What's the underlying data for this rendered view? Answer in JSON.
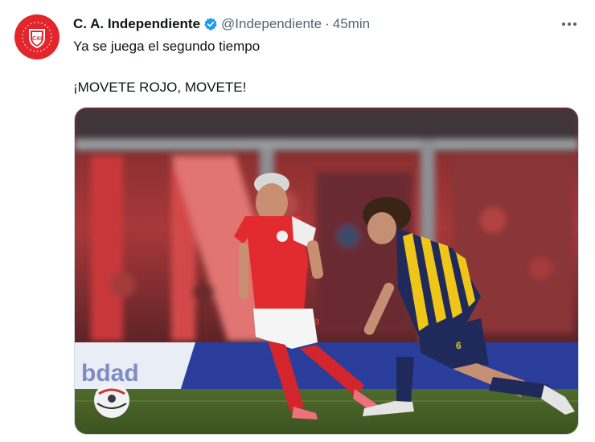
{
  "tweet": {
    "display_name": "C. A. Independiente",
    "handle": "@Independiente",
    "separator": "·",
    "time": "45min",
    "text_line_1": "Ya se juega el segundo tiempo",
    "text_line_2": "¡MOVETE ROJO, MOVETE!",
    "avatar_label": "CAI",
    "verified_icon": "verified-badge-icon",
    "more_icon": "more-options-icon"
  },
  "media": {
    "board_text": "bdad",
    "player_red_number": "9",
    "player_blue_number": "6"
  },
  "colors": {
    "brand_red": "#e3262c",
    "verified_blue": "#1d9bf0",
    "secondary_text": "#536471"
  }
}
